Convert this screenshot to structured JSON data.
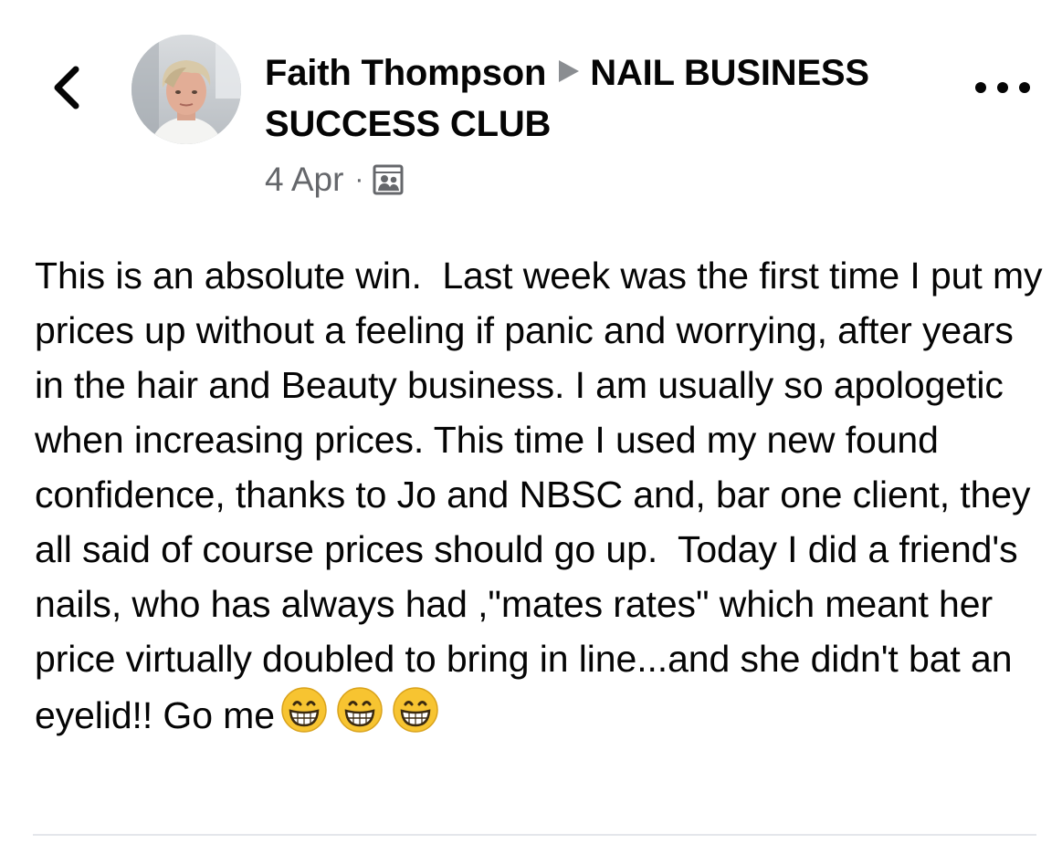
{
  "header": {
    "author": "Faith Thompson",
    "group": "NAIL BUSINESS SUCCESS CLUB",
    "date": "4 Apr",
    "separator": "·",
    "audience_icon": "group-members-icon"
  },
  "icons": {
    "back": "chevron-left-icon",
    "more": "more-horizontal-icon",
    "emoji": "grinning-face-emoji"
  },
  "post": {
    "text": "This is an absolute win.  Last week was the first time I put my prices up without a feeling if panic and worrying, after years in the hair and Beauty business. I am usually so apologetic when increasing prices. This time I used my new found confidence, thanks to Jo and NBSC and, bar one client, they all said of course prices should go up.  Today I did a friend's nails, who has always had ,\"mates rates\" which meant her price virtually doubled to bring in line...and she didn't bat an eyelid!! Go me",
    "emoji_count": 3
  },
  "colors": {
    "text": "#050505",
    "secondary_text": "#65676b",
    "arrow": "#8a8d91",
    "divider": "#e4e6eb",
    "emoji_face": "#f7c431"
  }
}
